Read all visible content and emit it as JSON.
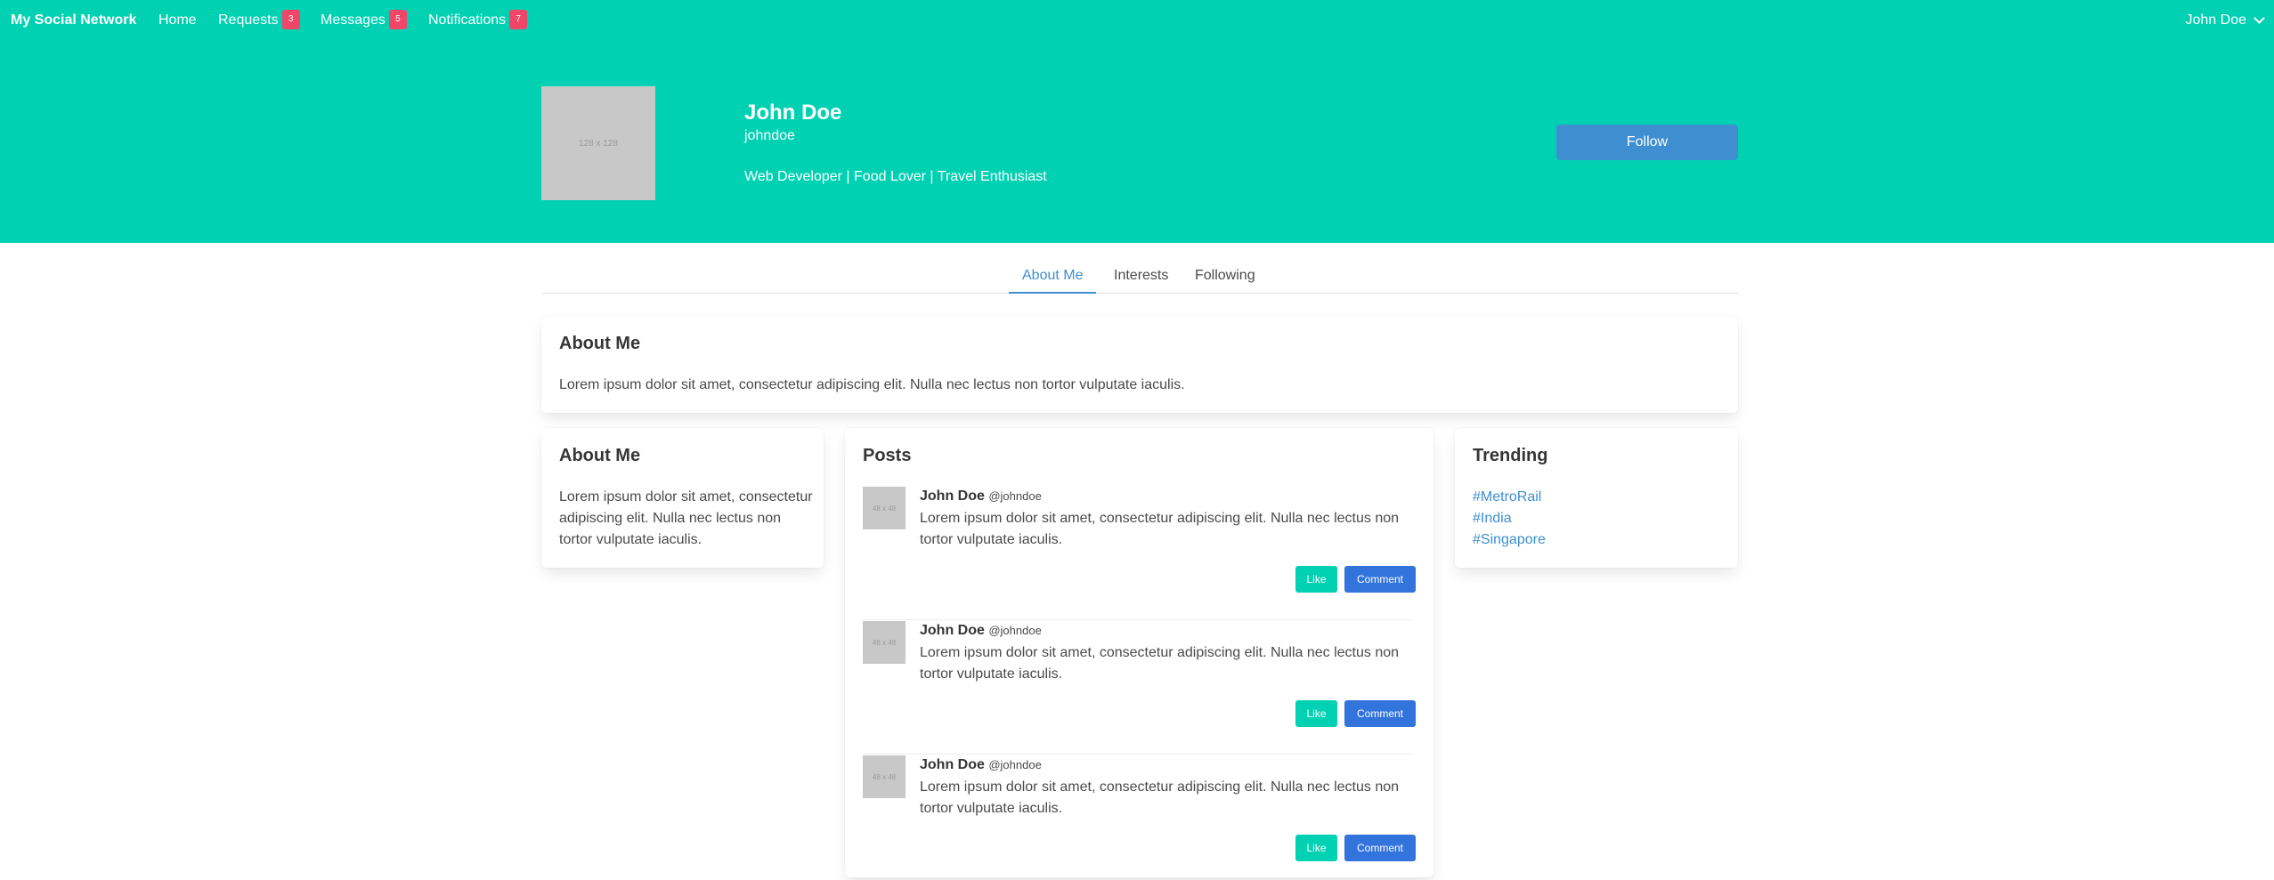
{
  "navbar": {
    "brand": "My Social Network",
    "items": [
      {
        "label": "Home"
      },
      {
        "label": "Requests",
        "badge": "3"
      },
      {
        "label": "Messages",
        "badge": "5"
      },
      {
        "label": "Notifications",
        "badge": "7"
      }
    ],
    "user": "John Doe"
  },
  "profile": {
    "avatar_placeholder": "128 x 128",
    "name": "John Doe",
    "handle": "johndoe",
    "bio": "Web Developer | Food Lover | Travel Enthusiast",
    "follow_label": "Follow"
  },
  "tabs": [
    {
      "label": "About Me",
      "active": true
    },
    {
      "label": "Interests",
      "active": false
    },
    {
      "label": "Following",
      "active": false
    }
  ],
  "about_main": {
    "title": "About Me",
    "text": "Lorem ipsum dolor sit amet, consectetur adipiscing elit. Nulla nec lectus non tortor vulputate iaculis."
  },
  "about_side": {
    "title": "About Me",
    "text": "Lorem ipsum dolor sit amet, consectetur adipiscing elit. Nulla nec lectus non tortor vulputate iaculis."
  },
  "posts": {
    "title": "Posts",
    "items": [
      {
        "avatar_placeholder": "48 x 48",
        "author": "John Doe",
        "handle": "@johndoe",
        "body": "Lorem ipsum dolor sit amet, consectetur adipiscing elit. Nulla nec lectus non tortor vulputate iaculis.",
        "like_label": "Like",
        "comment_label": "Comment"
      },
      {
        "avatar_placeholder": "48 x 48",
        "author": "John Doe",
        "handle": "@johndoe",
        "body": "Lorem ipsum dolor sit amet, consectetur adipiscing elit. Nulla nec lectus non tortor vulputate iaculis.",
        "like_label": "Like",
        "comment_label": "Comment"
      },
      {
        "avatar_placeholder": "48 x 48",
        "author": "John Doe",
        "handle": "@johndoe",
        "body": "Lorem ipsum dolor sit amet, consectetur adipiscing elit. Nulla nec lectus non tortor vulputate iaculis.",
        "like_label": "Like",
        "comment_label": "Comment"
      }
    ]
  },
  "trending": {
    "title": "Trending",
    "tags": [
      "#MetroRail",
      "#India",
      "#Singapore"
    ]
  },
  "colors": {
    "primary": "#00d1b2",
    "info": "#3e8ed0",
    "link": "#3273dc",
    "danger": "#f14668"
  },
  "icons": {
    "user_menu": "chevron-down-icon"
  }
}
